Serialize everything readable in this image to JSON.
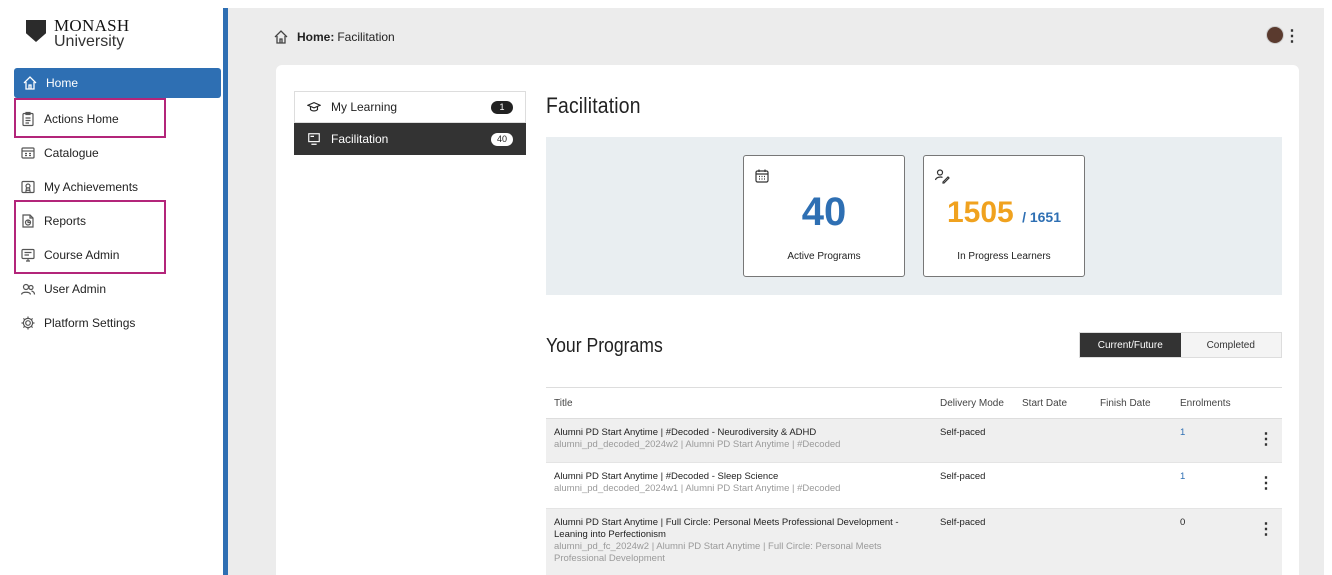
{
  "brand": {
    "line1": "MONASH",
    "line2": "University"
  },
  "sidebar": {
    "items": [
      {
        "label": "Home",
        "icon": "home-icon"
      },
      {
        "label": "Actions Home",
        "icon": "clipboard-icon"
      },
      {
        "label": "Catalogue",
        "icon": "catalogue-icon"
      },
      {
        "label": "My Achievements",
        "icon": "achievement-icon"
      },
      {
        "label": "Reports",
        "icon": "report-icon"
      },
      {
        "label": "Course Admin",
        "icon": "course-admin-icon"
      },
      {
        "label": "User Admin",
        "icon": "users-icon"
      },
      {
        "label": "Platform Settings",
        "icon": "gear-icon"
      }
    ]
  },
  "header": {
    "crumb_bold": "Home:",
    "crumb_page": "Facilitation"
  },
  "leftnav": {
    "items": [
      {
        "label": "My Learning",
        "count": "1"
      },
      {
        "label": "Facilitation",
        "count": "40"
      }
    ]
  },
  "page": {
    "title": "Facilitation"
  },
  "stats": {
    "active": {
      "value": "40",
      "label": "Active Programs"
    },
    "learners": {
      "value": "1505",
      "total": "/ 1651",
      "label": "In Progress Learners"
    }
  },
  "programs": {
    "title": "Your Programs",
    "toggle": {
      "current": "Current/Future",
      "completed": "Completed"
    },
    "columns": {
      "title": "Title",
      "mode": "Delivery Mode",
      "start": "Start Date",
      "finish": "Finish Date",
      "enrol": "Enrolments"
    },
    "rows": [
      {
        "title": "Alumni PD Start Anytime | #Decoded - Neurodiversity & ADHD",
        "sub": "alumni_pd_decoded_2024w2 | Alumni PD Start Anytime | #Decoded",
        "mode": "Self-paced",
        "start": "",
        "finish": "",
        "enrol": "1"
      },
      {
        "title": "Alumni PD Start Anytime | #Decoded - Sleep Science",
        "sub": "alumni_pd_decoded_2024w1 | Alumni PD Start Anytime | #Decoded",
        "mode": "Self-paced",
        "start": "",
        "finish": "",
        "enrol": "1"
      },
      {
        "title": "Alumni PD Start Anytime | Full Circle: Personal Meets Professional Development - Leaning into Perfectionism",
        "sub": "alumni_pd_fc_2024w2 | Alumni PD Start Anytime | Full Circle: Personal Meets Professional Development",
        "mode": "Self-paced",
        "start": "",
        "finish": "",
        "enrol": "0"
      }
    ]
  },
  "colors": {
    "accent": "#2e6fb3",
    "highlight": "#b3257a",
    "orange": "#f0a21f",
    "dark": "#333333"
  }
}
